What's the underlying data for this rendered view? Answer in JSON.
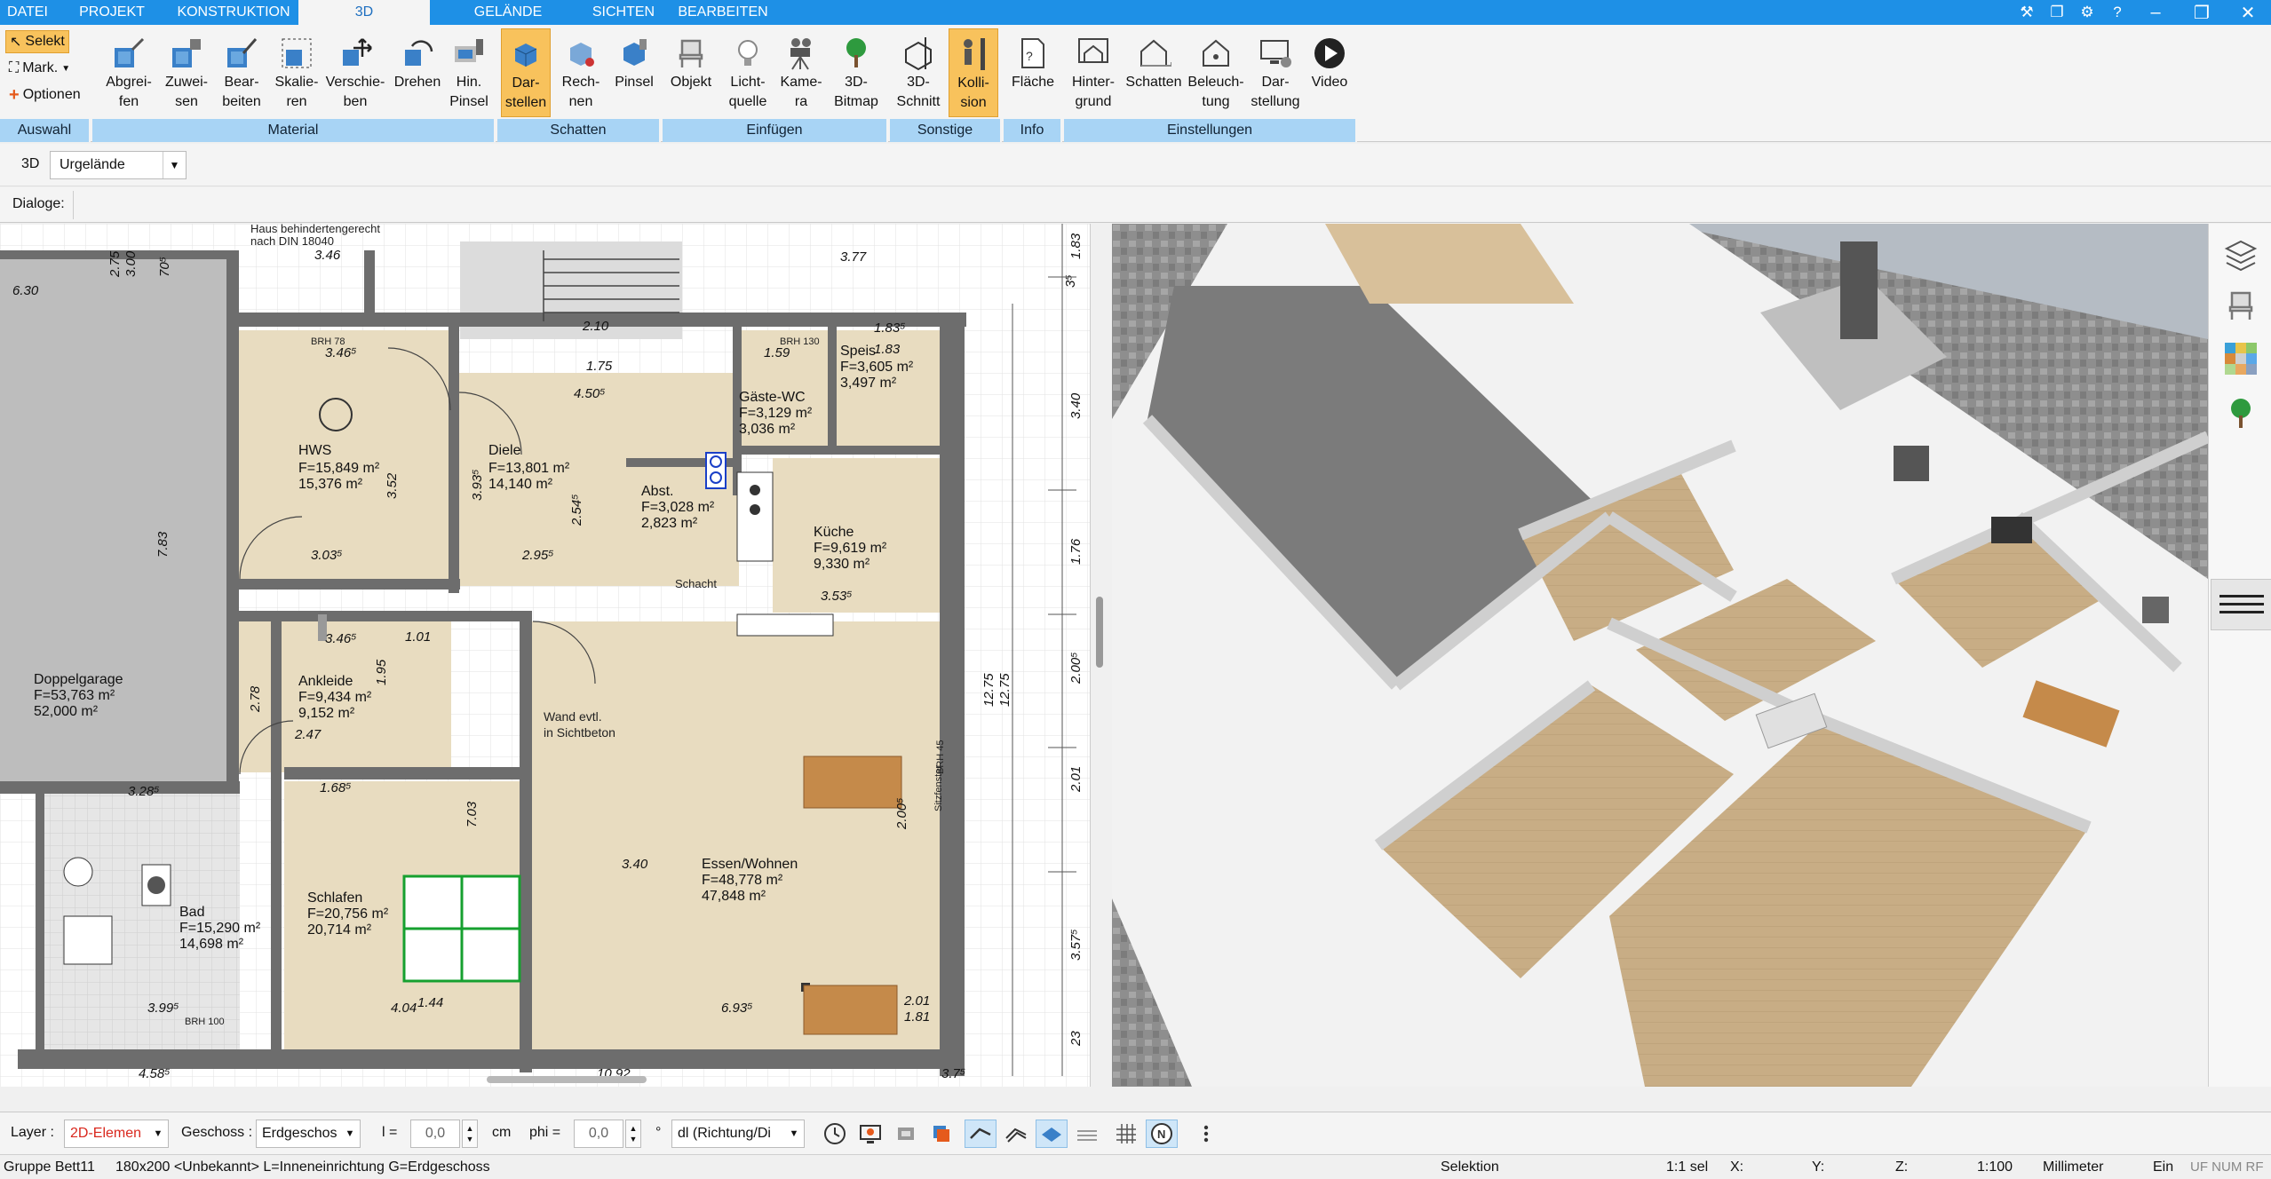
{
  "menu": {
    "tabs": [
      "DATEI",
      "PROJEKT",
      "KONSTRUKTION",
      "3D",
      "GELÄNDE",
      "SICHTEN",
      "BEARBEITEN"
    ],
    "active": "3D"
  },
  "ribbon": {
    "auswahl": {
      "label": "Auswahl",
      "selekt": "Selekt",
      "mark": "Mark.",
      "optionen": "Optionen"
    },
    "material": {
      "label": "Material",
      "buttons": [
        "Abgrei-\nfen",
        "Zuwei-\nsen",
        "Bear-\nbeiten",
        "Skalie-\nren",
        "Verschie-\nben",
        "Drehen",
        "Hin.\nPinsel"
      ]
    },
    "schatten": {
      "label": "Schatten",
      "buttons": [
        "Dar-\nstellen",
        "Rech-\nnen",
        "Pinsel"
      ]
    },
    "einfuegen": {
      "label": "Einfügen",
      "buttons": [
        "Objekt",
        "Licht-\nquelle",
        "Kame-\nra",
        "3D-\nBitmap"
      ]
    },
    "sonstige": {
      "label": "Sonstige",
      "buttons": [
        "3D-\nSchnitt",
        "Kolli-\nsion"
      ]
    },
    "info": {
      "label": "Info",
      "buttons": [
        "Fläche"
      ]
    },
    "einstellungen": {
      "label": "Einstellungen",
      "buttons": [
        "Hinter-\ngrund",
        "Schatten",
        "Beleuch-\ntung",
        "Dar-\nstellung",
        "Video"
      ]
    }
  },
  "row3d": {
    "label": "3D",
    "combo": "Urgelände"
  },
  "dialoge": {
    "label": "Dialoge:"
  },
  "plan": {
    "rooms": [
      {
        "name": "HWS",
        "area1": "F=15,849 m²",
        "area2": "15,376 m²"
      },
      {
        "name": "Diele",
        "area1": "F=13,801 m²",
        "area2": "14,140 m²"
      },
      {
        "name": "Gäste-WC",
        "area1": "F=3,129 m²",
        "area2": "3,036 m²"
      },
      {
        "name": "Speis",
        "area1": "F=3,605 m²",
        "area2": "3,497 m²"
      },
      {
        "name": "Abst.",
        "area1": "F=3,028 m²",
        "area2": "2,823 m²"
      },
      {
        "name": "Küche",
        "area1": "F=9,619 m²",
        "area2": "9,330 m²"
      },
      {
        "name": "Ankleide",
        "area1": "F=9,434 m²",
        "area2": "9,152 m²"
      },
      {
        "name": "Doppelgarage",
        "area1": "F=53,763 m²",
        "area2": "52,000 m²"
      },
      {
        "name": "Bad",
        "area1": "F=15,290 m²",
        "area2": "14,698 m²"
      },
      {
        "name": "Schlafen",
        "area1": "F=20,756 m²",
        "area2": "20,714 m²"
      },
      {
        "name": "Essen/Wohnen",
        "area1": "F=48,778 m²",
        "area2": "47,848 m²"
      }
    ],
    "notes": {
      "header1": "Haus behindertengerecht",
      "header2": "nach DIN 18040",
      "wand1": "Wand evtl.",
      "wand2": "in Sichtbeton",
      "brh78": "BRH 78",
      "brh130": "BRH 130",
      "brh100": "BRH 100",
      "brh45": "BRH 45",
      "sitzfenster": "Sitzfenster",
      "schacht": "Schacht"
    },
    "dims": {
      "top": [
        "3.46",
        "6.30",
        "3.77",
        "4.50⁵",
        "3.46⁵",
        "1.75",
        "2.10",
        "1.83⁵",
        "1.83",
        "1.59"
      ],
      "inner": [
        "3.03⁵",
        "2.95⁵",
        "3.53⁵",
        "3.46⁵",
        "2.78",
        "2.47",
        "1.68⁵",
        "4.04",
        "6.93⁵",
        "3.28⁵",
        "3.99⁵",
        "7.83",
        "7.03",
        "3.93⁵",
        "3.52",
        "2.00⁵",
        "1.44",
        "1.95",
        "2.54⁵",
        "2.01",
        "1.01",
        "1.81",
        "3.40",
        "10.92",
        "4.58⁵",
        "3.7⁵",
        "2.75",
        "3.00",
        "70⁵"
      ],
      "right": [
        "1.83",
        "3.40",
        "1.76",
        "2.00⁵",
        "2.01",
        "3.57⁵",
        "23",
        "12.75",
        "12.75",
        "3⁵"
      ]
    }
  },
  "bottom": {
    "layer_label": "Layer :",
    "layer_value": "2D-Elemen",
    "geschoss_label": "Geschoss :",
    "geschoss_value": "Erdgeschos",
    "l_label": "l =",
    "l_value": "0,0",
    "l_unit": "cm",
    "phi_label": "phi =",
    "phi_value": "0,0",
    "phi_unit": "°",
    "dl_value": "dl (Richtung/Di"
  },
  "status": {
    "gruppe": "Gruppe Bett11",
    "info": "180x200 <Unbekannt> L=Inneneinrichtung G=Erdgeschoss",
    "mode": "Selektion",
    "sel": "1:1 sel",
    "x": "X:",
    "y": "Y:",
    "z": "Z:",
    "scale": "1:100",
    "unit": "Millimeter",
    "ein": "Ein",
    "flags": "UF NUM RF"
  },
  "colors": {
    "accent": "#1e90e6",
    "group_label": "#a8d4f5",
    "highlight": "#f8c25c",
    "floor": "#e8dcc0",
    "wall": "#6d6d6d"
  }
}
